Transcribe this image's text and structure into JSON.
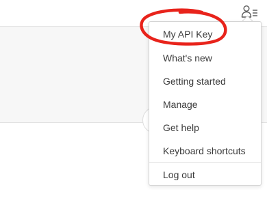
{
  "header": {
    "user_menu_icon": "user-menu-icon"
  },
  "menu": {
    "items": [
      {
        "label": "My API Key"
      },
      {
        "label": "What's new"
      },
      {
        "label": "Getting started"
      },
      {
        "label": "Manage"
      },
      {
        "label": "Get help"
      },
      {
        "label": "Keyboard shortcuts"
      },
      {
        "label": "Log out"
      }
    ]
  },
  "annotation": {
    "color": "#e8231b",
    "shape": "hand-drawn circle around My API Key"
  },
  "colors": {
    "menu_text": "#3a3a3a",
    "border": "#d4d4d4",
    "band_background": "#f7f7f7"
  }
}
